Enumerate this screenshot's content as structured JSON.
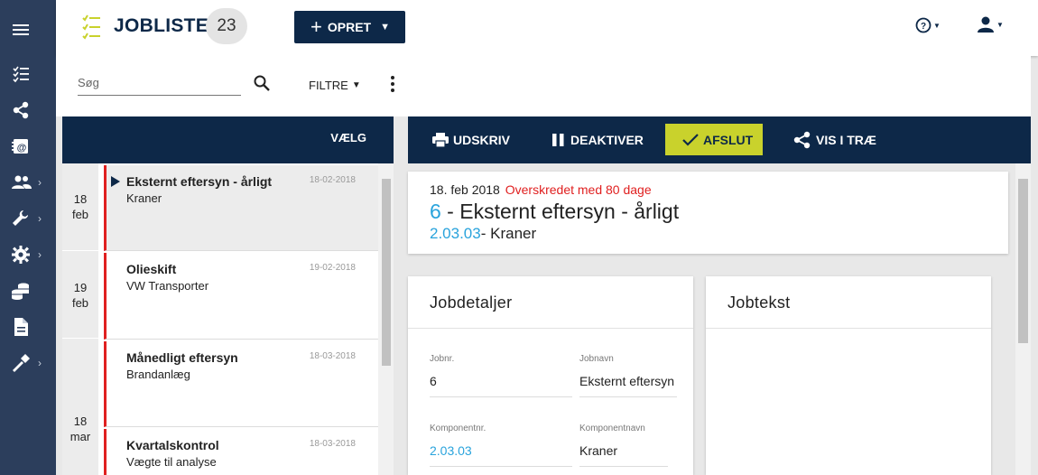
{
  "header": {
    "title": "JOBLISTE",
    "count": "23",
    "create_label": "OPRET"
  },
  "search": {
    "placeholder": "Søg"
  },
  "filter_label": "FILTRE",
  "list": {
    "select_label": "VÆLG",
    "groups": [
      {
        "day": "18",
        "month": "feb"
      },
      {
        "day": "19",
        "month": "feb"
      },
      {
        "day": "18",
        "month": "mar"
      }
    ],
    "items": [
      {
        "name": "Eksternt eftersyn - årligt",
        "sub": "Kraner",
        "date": "18-02-2018"
      },
      {
        "name": "Olieskift",
        "sub": "VW Transporter",
        "date": "19-02-2018"
      },
      {
        "name": "Månedligt eftersyn",
        "sub": "Brandanlæg",
        "date": "18-03-2018"
      },
      {
        "name": "Kvartalskontrol",
        "sub": "Vægte til analyse",
        "date": "18-03-2018"
      }
    ]
  },
  "toolbar": {
    "print": "UDSKRIV",
    "deactivate": "DEAKTIVER",
    "finish": "AFSLUT",
    "tree": "VIS I TRÆ"
  },
  "job": {
    "date": "18. feb 2018",
    "overdue": "Overskredet med 80 dage",
    "number": "6",
    "name": " - Eksternt eftersyn - årligt",
    "component_code": "2.03.03",
    "component_name": "- Kraner"
  },
  "details": {
    "title": "Jobdetaljer",
    "jobnr_label": "Jobnr.",
    "jobnr_value": "6",
    "jobnavn_label": "Jobnavn",
    "jobnavn_value": "Eksternt eftersyn",
    "komponentnr_label": "Komponentnr.",
    "komponentnr_value": "2.03.03",
    "komponentnavn_label": "Komponentnavn",
    "komponentnavn_value": "Kraner"
  },
  "jobtext": {
    "title": "Jobtekst"
  },
  "colors": {
    "navy": "#0d2848",
    "rail": "#2c3e5c",
    "accent": "#c9d22c",
    "link": "#29a3dc",
    "alert": "#e02020"
  },
  "icons": {
    "rail": [
      "menu-icon",
      "list-icon",
      "share-icon",
      "contacts-icon",
      "people-icon",
      "wrench-icon",
      "gear-icon",
      "coins-icon",
      "document-icon",
      "hammer-icon"
    ]
  }
}
